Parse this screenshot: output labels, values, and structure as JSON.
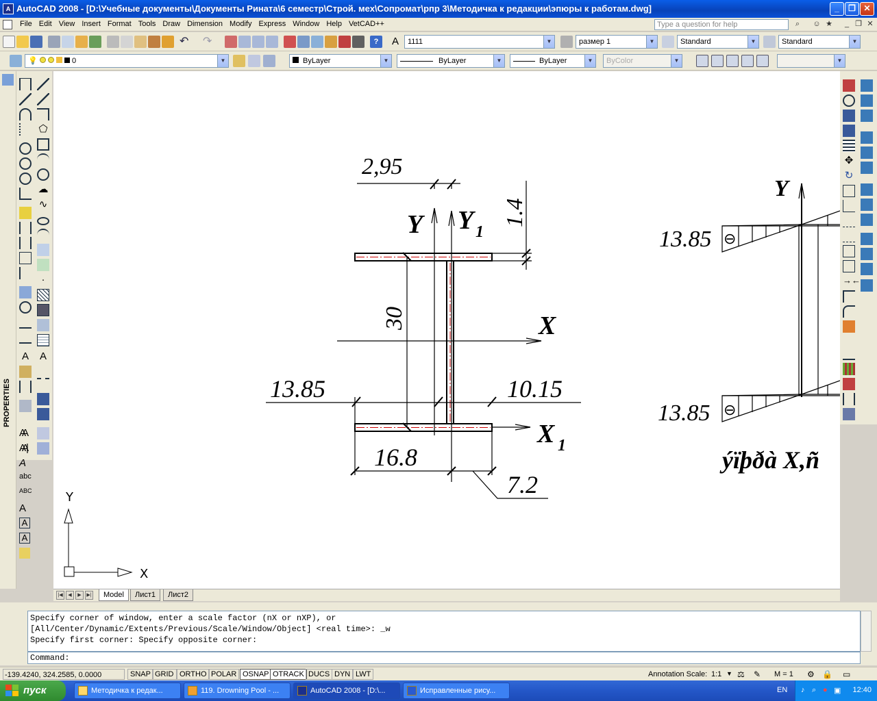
{
  "titlebar": {
    "app_icon_text": "A",
    "title": "AutoCAD 2008 - [D:\\Учебные документы\\Документы Рината\\6 семестр\\Строй. мех\\Сопромат\\рпр 3\\Методичка к редакции\\эпюры к работам.dwg]",
    "minimize": "_",
    "restore": "❐",
    "close": "✕"
  },
  "menubar": {
    "items": [
      "File",
      "Edit",
      "View",
      "Insert",
      "Format",
      "Tools",
      "Draw",
      "Dimension",
      "Modify",
      "Express",
      "Window",
      "Help",
      "VetCAD++"
    ],
    "help_placeholder": "Type a question for help"
  },
  "toolbar1": {
    "text_style_combo": "1111",
    "dim_style_combo": "размер 1",
    "table_style_combo": "Standard",
    "multileader_style_combo": "Standard"
  },
  "toolbar2": {
    "layer_combo": "0",
    "color_combo": "ByLayer",
    "linetype_combo": "ByLayer",
    "lineweight_combo": "ByLayer",
    "plotstyle_combo": "ByColor"
  },
  "palette": {
    "properties_label": "PROPERTIES"
  },
  "drawing": {
    "dim_web_thickness": "2,95",
    "dim_flange_thickness": "1.4",
    "dim_height": "30",
    "dim_left": "13.85",
    "dim_right": "10.15",
    "dim_flange_width": "16.8",
    "dim_offset": "7.2",
    "label_y": "Y",
    "label_y1": "Y",
    "label_y1_sub": "1",
    "label_x": "X",
    "label_x1": "X",
    "label_x1_sub": "1",
    "diagram_top_value": "13.85",
    "diagram_bottom_value": "13.85",
    "diagram_y_label": "Y",
    "diagram_sign": "⊖",
    "diagram_caption": "ýïþðà X,ñ",
    "ucs_x": "X",
    "ucs_y": "Y"
  },
  "layout_tabs": [
    "Model",
    "Лист1",
    "Лист2"
  ],
  "command": {
    "history": [
      "Specify corner of window, enter a scale factor (nX or nXP), or",
      "[All/Center/Dynamic/Extents/Previous/Scale/Window/Object] <real time>: _w",
      "Specify first corner: Specify opposite corner:"
    ],
    "prompt": "Command:"
  },
  "statusbar": {
    "coordinates": "-139.4240, 324.2585, 0.0000",
    "toggles": [
      {
        "label": "SNAP",
        "on": false
      },
      {
        "label": "GRID",
        "on": false
      },
      {
        "label": "ORTHO",
        "on": false
      },
      {
        "label": "POLAR",
        "on": false
      },
      {
        "label": "OSNAP",
        "on": true
      },
      {
        "label": "OTRACK",
        "on": true
      },
      {
        "label": "DUCS",
        "on": false
      },
      {
        "label": "DYN",
        "on": false
      },
      {
        "label": "LWT",
        "on": false
      }
    ],
    "annotation_scale_label": "Annotation Scale:",
    "annotation_scale_value": "1:1",
    "m_value": "M = 1"
  },
  "taskbar": {
    "start_label": "пуск",
    "tasks": [
      {
        "label": "Методичка к редак...",
        "active": false
      },
      {
        "label": "119. Drowning Pool - ...",
        "active": false
      },
      {
        "label": "AutoCAD 2008 - [D:\\...",
        "active": true
      },
      {
        "label": "Исправленные рису...",
        "active": false
      }
    ],
    "language": "EN",
    "clock": "12:40"
  },
  "colors": {
    "title_blue": "#0842b8",
    "flange_red": "#cc0000",
    "taskbar_blue": "#2457c8",
    "start_green": "#2f8a2f"
  }
}
